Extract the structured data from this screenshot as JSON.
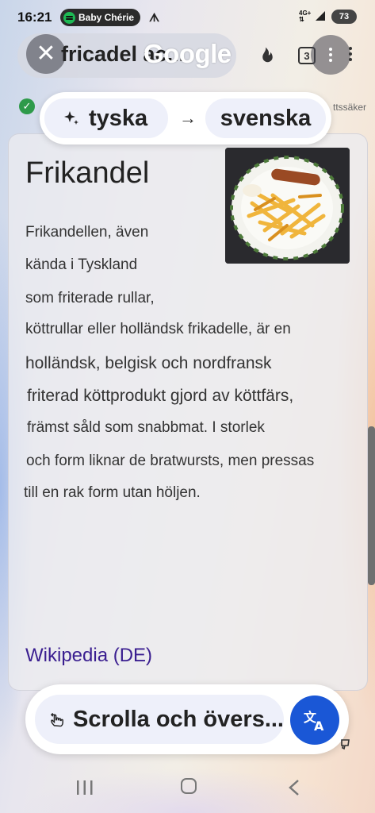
{
  "status_bar": {
    "time": "16:21",
    "media_label": "Baby Chérie",
    "network_top": "4G+",
    "network_bottom": "⇅",
    "battery": "73"
  },
  "search": {
    "query": "fricadel ac...",
    "brand": "Google",
    "tab_count": "3",
    "close_icon": "close-icon",
    "menu_icon": "more-vert-icon"
  },
  "translate": {
    "source_lang": "tyska",
    "target_lang": "svenska",
    "arrow": "→",
    "hint_partial": "ttssäker",
    "scroll_label": "Scrolla och övers...",
    "accent": "#1a57d6"
  },
  "article": {
    "title": "Frikandel",
    "lines": [
      "Frikandellen, även",
      "kända i Tyskland",
      "som friterade rullar,",
      "köttrullar eller holländsk frikadelle, är en",
      "holländsk, belgisk och nordfransk",
      "friterad köttprodukt gjord av köttfärs,",
      "främst såld som snabbmat. I storlek",
      "och form liknar de bratwursts, men pressas",
      "till en rak form utan höljen."
    ],
    "source_link": "Wikipedia (DE)"
  }
}
